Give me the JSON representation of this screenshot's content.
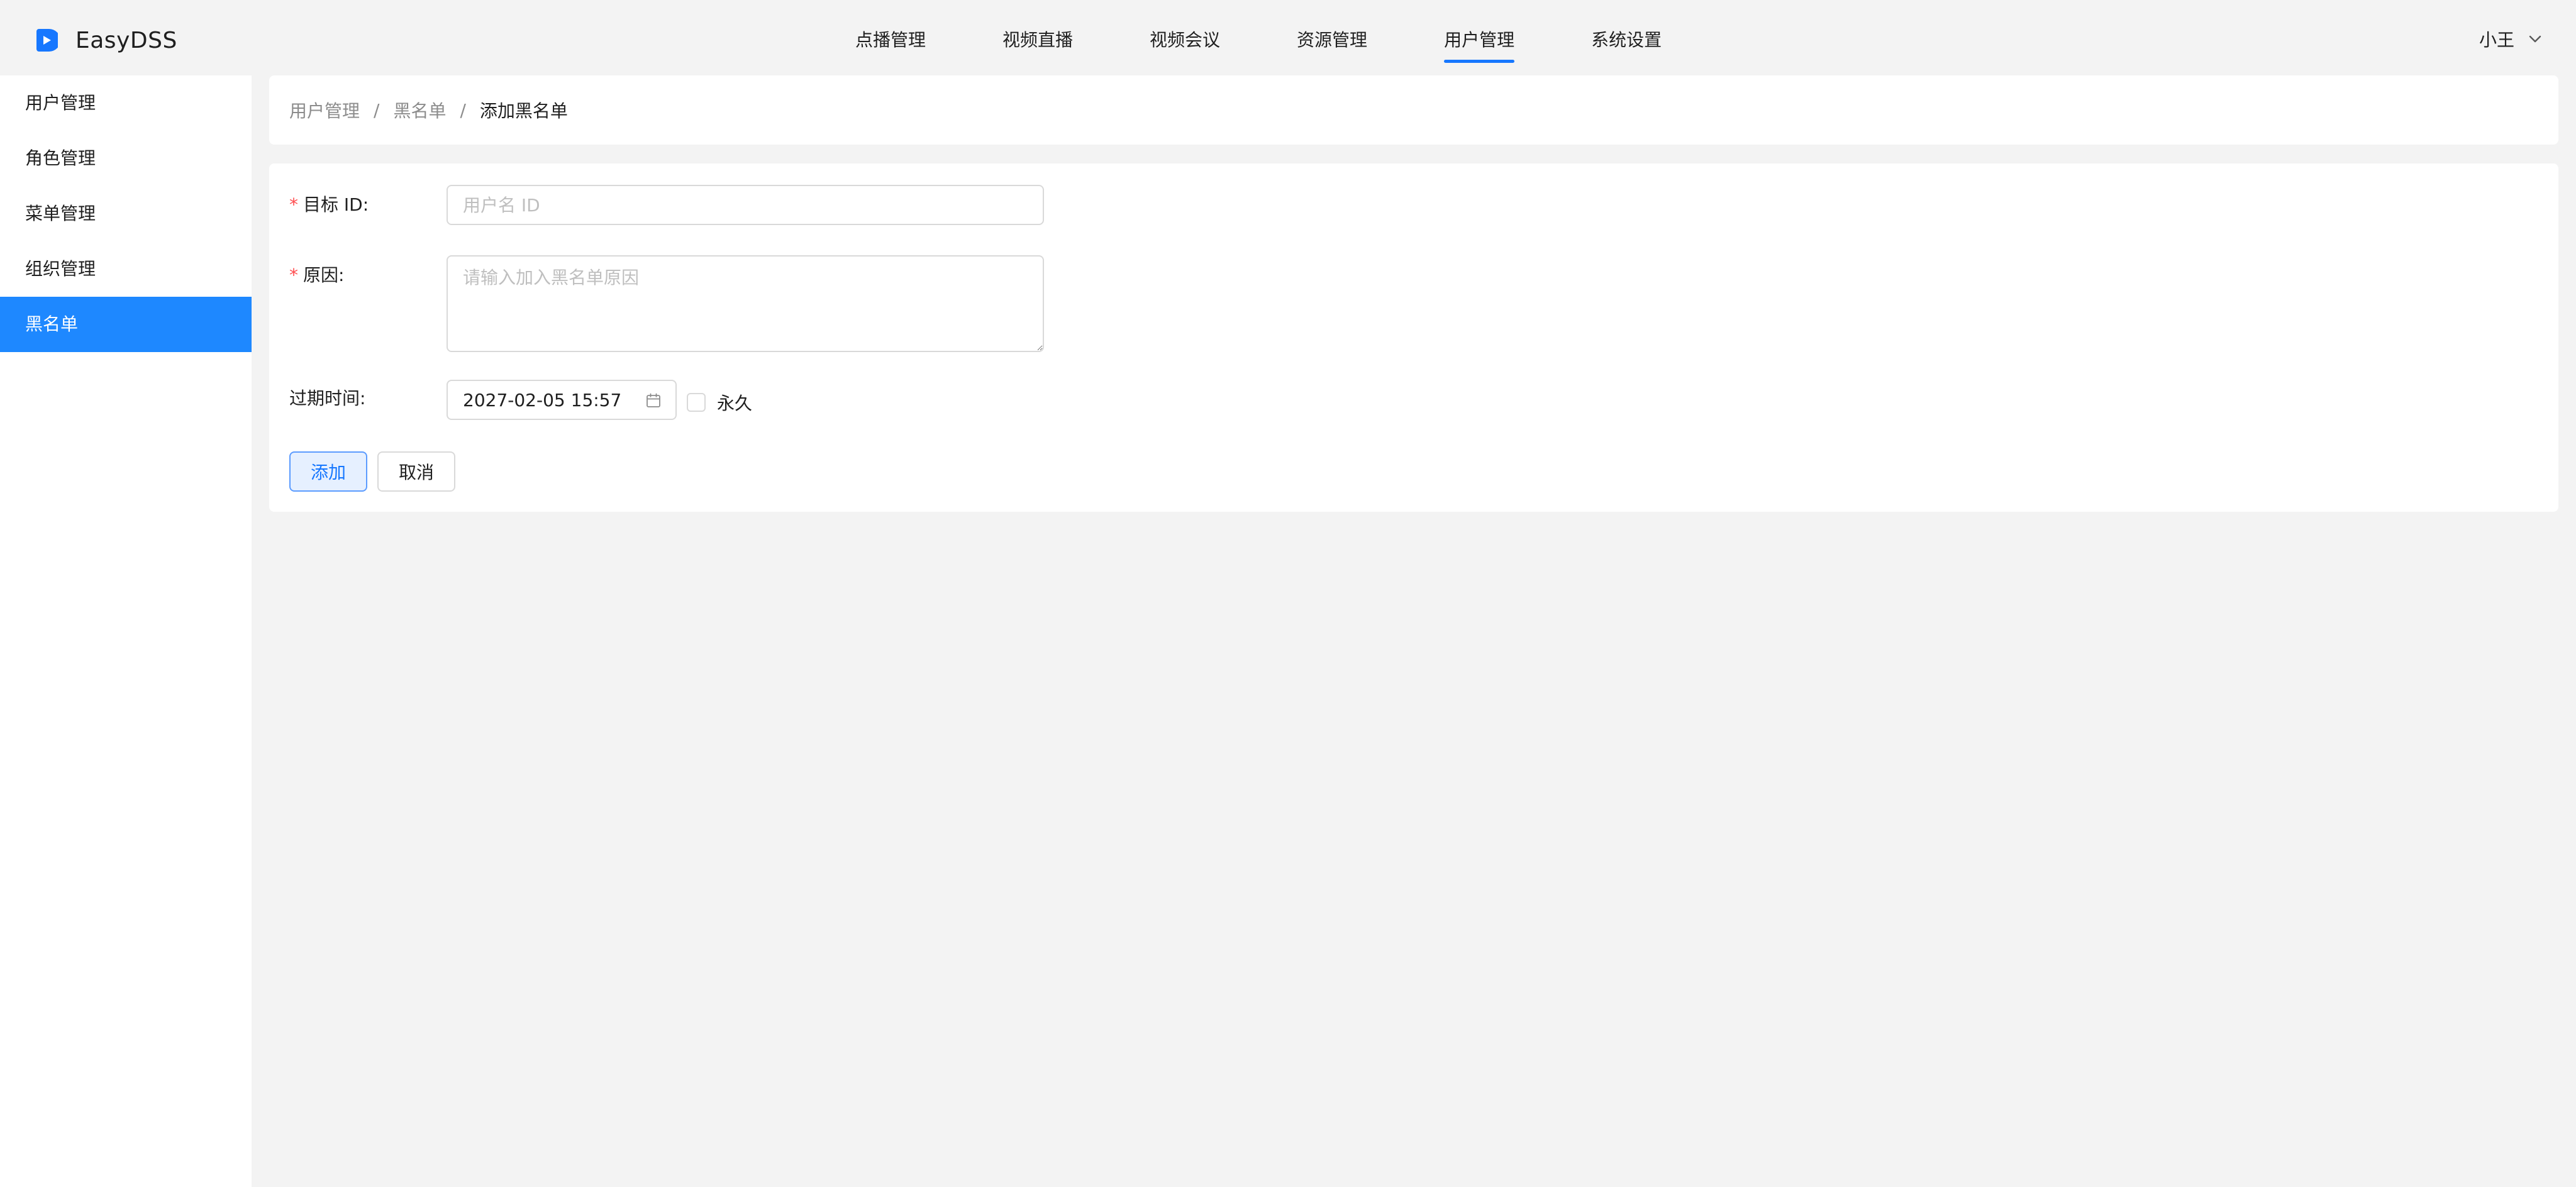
{
  "app": {
    "name": "EasyDSS",
    "brand_color": "#1677ff"
  },
  "header": {
    "nav": [
      {
        "label": "点播管理",
        "active": false
      },
      {
        "label": "视频直播",
        "active": false
      },
      {
        "label": "视频会议",
        "active": false
      },
      {
        "label": "资源管理",
        "active": false
      },
      {
        "label": "用户管理",
        "active": true
      },
      {
        "label": "系统设置",
        "active": false
      }
    ],
    "user": {
      "name": "小王",
      "icon": "chevron-down-icon"
    }
  },
  "sidebar": {
    "items": [
      {
        "label": "用户管理",
        "active": false
      },
      {
        "label": "角色管理",
        "active": false
      },
      {
        "label": "菜单管理",
        "active": false
      },
      {
        "label": "组织管理",
        "active": false
      },
      {
        "label": "黑名单",
        "active": true
      }
    ],
    "active_color": "#1e88ff"
  },
  "breadcrumb": {
    "items": [
      "用户管理",
      "黑名单"
    ],
    "separator": "/",
    "current": "添加黑名单"
  },
  "form": {
    "target_id": {
      "required_mark": "*",
      "label": "目标 ID",
      "colon": ":",
      "value": "",
      "placeholder": "用户名 ID"
    },
    "reason": {
      "required_mark": "*",
      "label": "原因",
      "colon": ":",
      "value": "",
      "placeholder": "请输入加入黑名单原因"
    },
    "expiry": {
      "label": "过期时间",
      "colon": ":",
      "value": "2027-02-05 15:57",
      "icon": "calendar-icon"
    },
    "permanent": {
      "label": "永久",
      "checked": false
    },
    "buttons": {
      "submit_label": "添加",
      "cancel_label": "取消"
    }
  }
}
